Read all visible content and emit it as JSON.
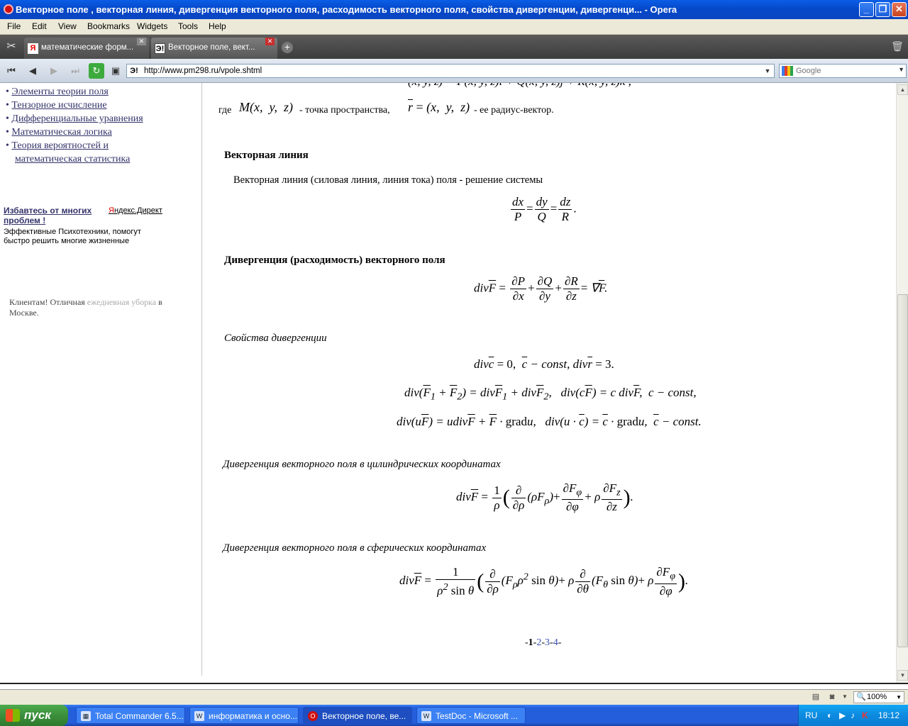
{
  "window": {
    "title": "Векторное поле , векторная линия, дивергенция векторного поля, расходимость векторного поля, свойства дивергенции, дивергенци... - Opera"
  },
  "menu": [
    "File",
    "Edit",
    "View",
    "Bookmarks",
    "Widgets",
    "Tools",
    "Help"
  ],
  "tabs": [
    {
      "label": "математические форм...",
      "icon": "Я"
    },
    {
      "label": "Векторное поле, вект...",
      "icon": "Э!"
    }
  ],
  "address": {
    "url": "http://www.pm298.ru/vpole.shtml",
    "site_icon": "Э!",
    "search_placeholder": "Google"
  },
  "sidebar": {
    "nav": [
      "Элементы теории поля",
      "Тензорное исчисление",
      "Дифференциальные уравнения",
      "Математическая логика",
      "Теория вероятностей и",
      "математическая статистика"
    ],
    "ad_title": "Избавтесь от многих проблем !",
    "ad_direct_y": "Я",
    "ad_direct_rest": "ндекс.Директ",
    "ad_text": "Эффективные Психотехники, помогут быстро решить многие жизненные",
    "promo_a": "Клиентам! Отличная",
    "promo_gray": "ежедневная уборка",
    "promo_b": "в Москве."
  },
  "article": {
    "where_prefix": "где",
    "point_text": "- точка пространства,",
    "radius_text": "- ее радиус-вектор.",
    "h_vector_line": "Векторная линия",
    "vector_line_text": "Векторная линия (силовая линия, линия тока) поля - решение системы",
    "h_divergence": "Дивергенция (расходимость) векторного поля",
    "h_properties": "Свойства дивергенции",
    "h_cylindrical": "Дивергенция векторного поля в цилиндрических координатах",
    "h_spherical": "Дивергенция векторного поля в сферических координатах"
  },
  "pager": {
    "current": "1",
    "pages": [
      "2",
      "3",
      "4"
    ]
  },
  "status": {
    "zoom": "100%"
  },
  "taskbar": {
    "start": "пуск",
    "tasks": [
      "Total Commander 6.5...",
      "информатика и осно...",
      "Векторное поле, ве...",
      "TestDoc - Microsoft ..."
    ],
    "lang": "RU",
    "clock": "18:12"
  }
}
